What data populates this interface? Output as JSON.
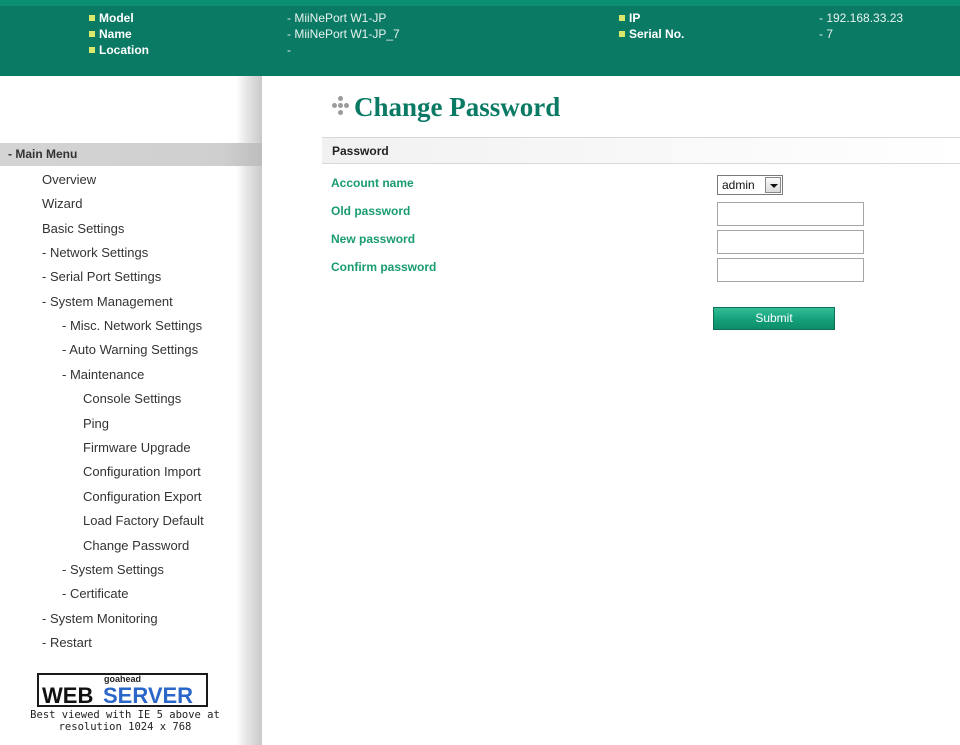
{
  "header": {
    "model_label": "Model",
    "model_value": "- MiiNePort W1-JP",
    "name_label": "Name",
    "name_value": "- MiiNePort W1-JP_7",
    "location_label": "Location",
    "location_value": "-",
    "ip_label": "IP",
    "ip_value": "- 192.168.33.23",
    "serial_label": "Serial No.",
    "serial_value": "- 7"
  },
  "sidebar": {
    "main_menu": "- Main Menu",
    "items": [
      "Overview",
      "Wizard",
      "Basic Settings",
      "- Network Settings",
      "- Serial Port Settings",
      "- System Management",
      "- Misc. Network Settings",
      "- Auto Warning Settings",
      "- Maintenance",
      "Console Settings",
      "Ping",
      "Firmware Upgrade",
      "Configuration Import",
      "Configuration Export",
      "Load Factory Default",
      "Change Password",
      "- System Settings",
      "- Certificate",
      "- System Monitoring",
      "- Restart"
    ],
    "logo": {
      "top": "goahead",
      "web": "WEB",
      "server": "SERVER"
    },
    "best_viewed_line1": "Best viewed with IE 5 above at",
    "best_viewed_line2": "resolution 1024 x 768"
  },
  "main": {
    "title": "Change Password",
    "section": "Password",
    "fields": {
      "account_name": "Account name",
      "old_password": "Old password",
      "new_password": "New password",
      "confirm_password": "Confirm password"
    },
    "account_selected": "admin",
    "submit_label": "Submit"
  },
  "colors": {
    "header_bg": "#0b7a65",
    "accent_green": "#199c6e",
    "title_green": "#0b7a65",
    "bullet_yellow": "#d8e86a",
    "logo_blue": "#2a67c9"
  },
  "icons": [
    "bullet-icon",
    "title-dots-icon",
    "dropdown-arrow-icon"
  ]
}
